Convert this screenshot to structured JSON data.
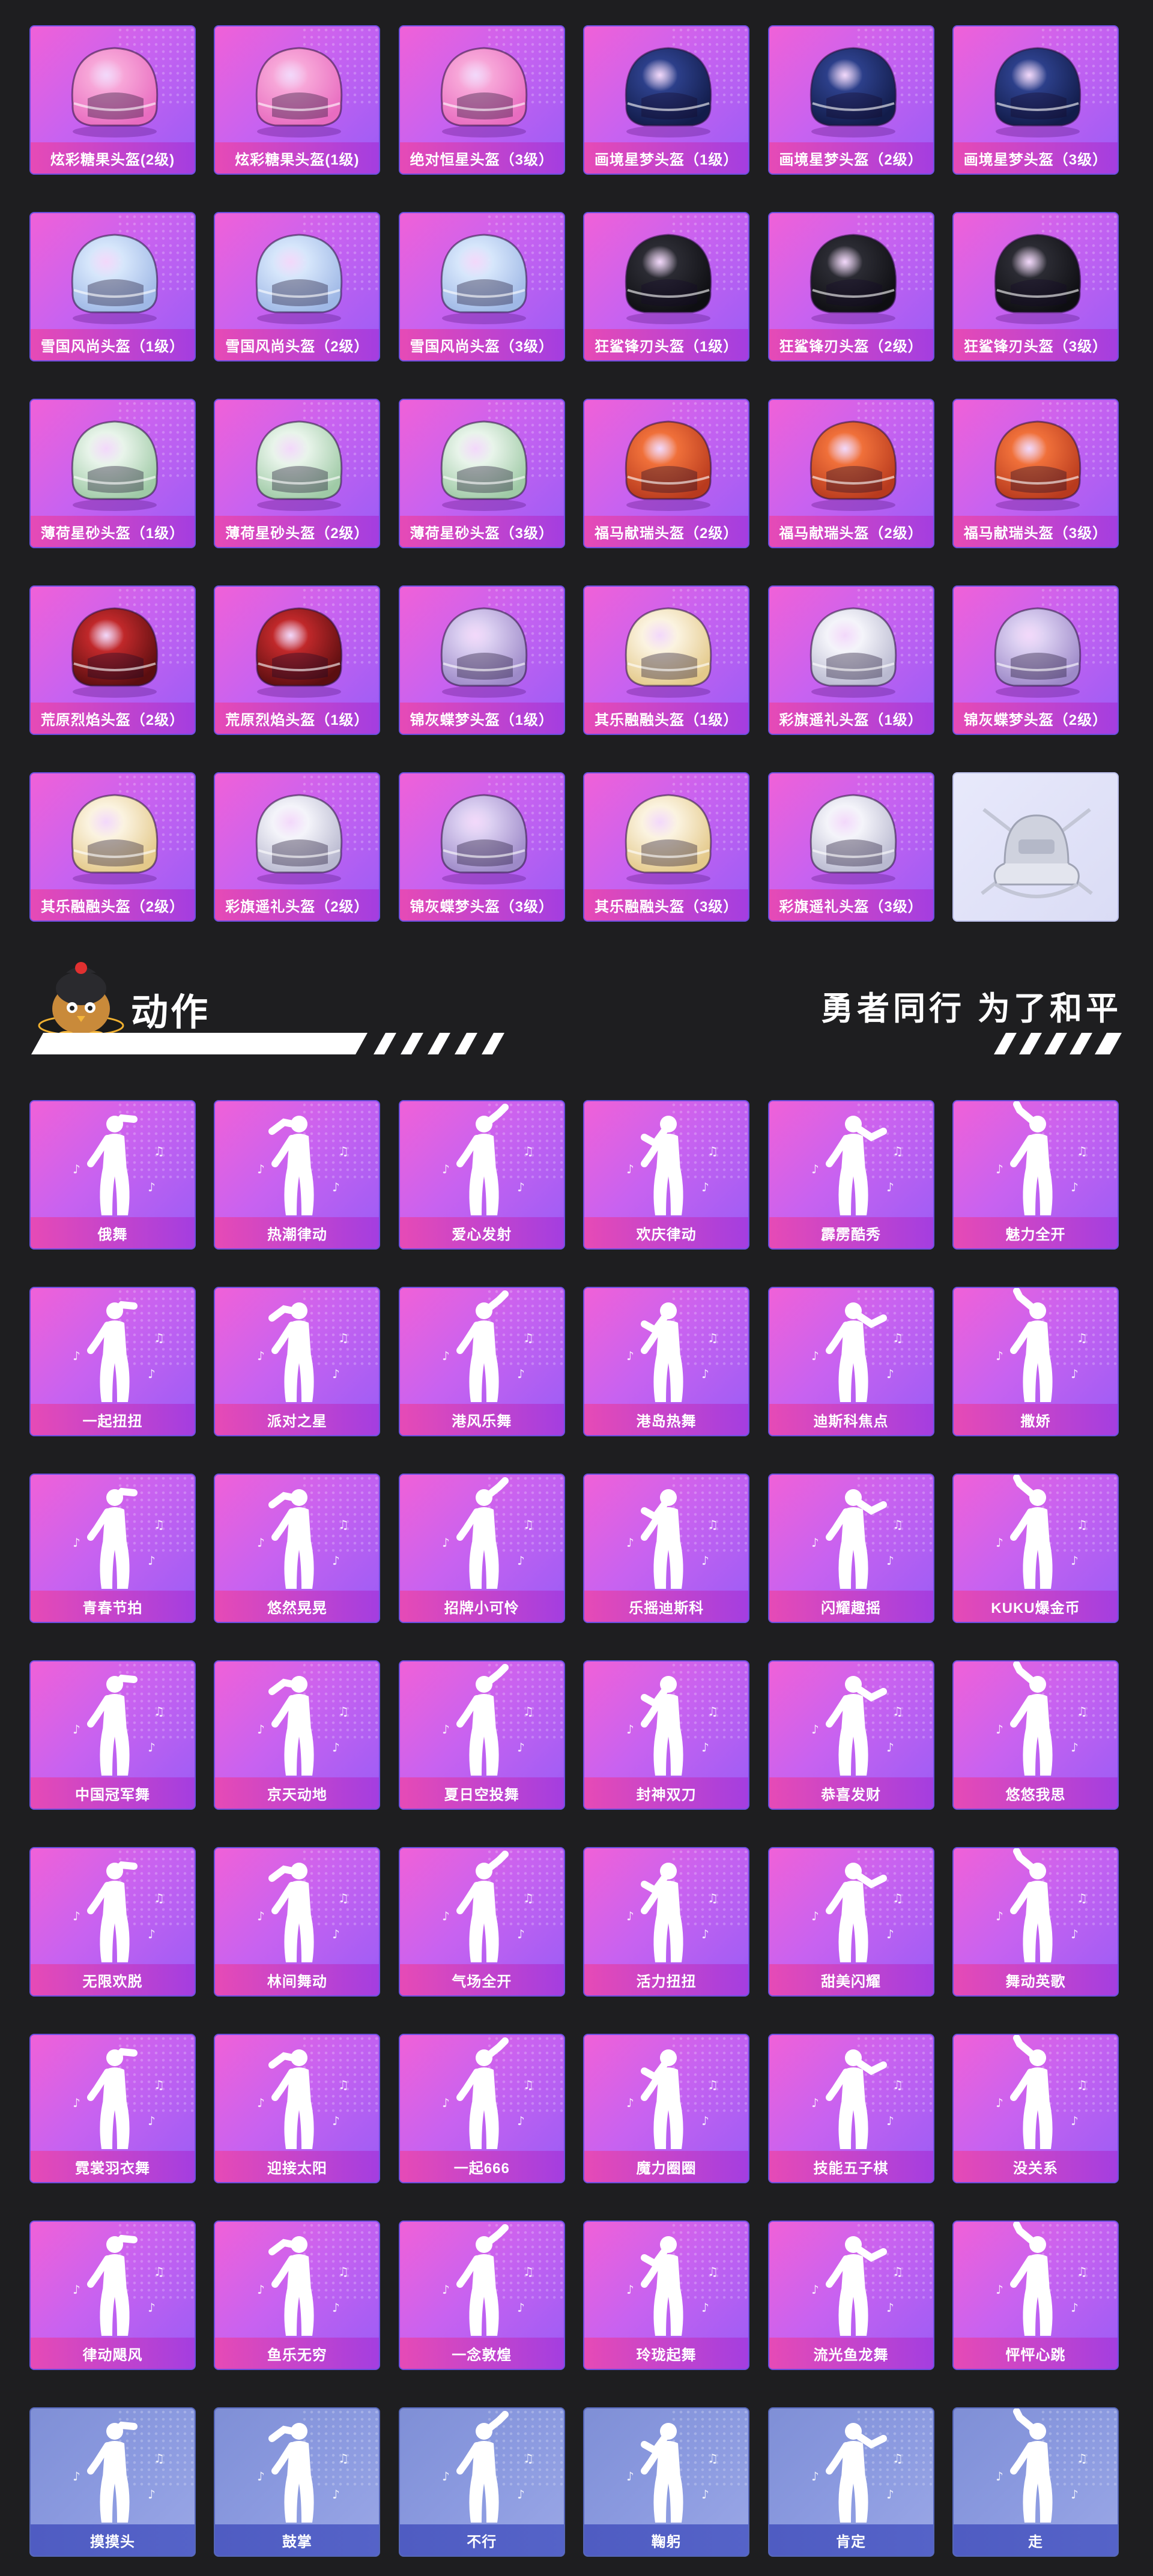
{
  "colors": {
    "background": "#1e1e20",
    "card_pink": "#f061d8",
    "card_purple": "#9a5cf5",
    "label_pink": "#e64ab6",
    "label_purple": "#a43ee0",
    "card_gray": "#8b9ae0",
    "label_gray": "#4f5cc2"
  },
  "helmets": [
    {
      "label": "炫彩糖果头盔(2级)",
      "icon": "pink-candy-helmet-icon",
      "tone": "pink"
    },
    {
      "label": "炫彩糖果头盔(1级)",
      "icon": "pink-candy-helmet-icon",
      "tone": "pink"
    },
    {
      "label": "绝对恒星头盔（3级）",
      "icon": "pink-star-helmet-icon",
      "tone": "pink"
    },
    {
      "label": "画境星梦头盔（1级）",
      "icon": "blue-star-helmet-icon",
      "tone": "blue"
    },
    {
      "label": "画境星梦头盔（2级）",
      "icon": "blue-star-helmet-icon",
      "tone": "blue"
    },
    {
      "label": "画境星梦头盔（3级）",
      "icon": "blue-star-helmet-icon",
      "tone": "blue"
    },
    {
      "label": "雪国风尚头盔（1级）",
      "icon": "snow-helmet-icon",
      "tone": "ice"
    },
    {
      "label": "雪国风尚头盔（2级）",
      "icon": "snow-helmet-icon",
      "tone": "ice"
    },
    {
      "label": "雪国风尚头盔（3级）",
      "icon": "snow-helmet-icon",
      "tone": "ice"
    },
    {
      "label": "狂鲨锋刃头盔（1级）",
      "icon": "shark-helmet-icon",
      "tone": "dark"
    },
    {
      "label": "狂鲨锋刃头盔（2级）",
      "icon": "shark-helmet-icon",
      "tone": "dark"
    },
    {
      "label": "狂鲨锋刃头盔（3级）",
      "icon": "shark-helmet-icon",
      "tone": "dark"
    },
    {
      "label": "薄荷星砂头盔（1级）",
      "icon": "mint-helmet-icon",
      "tone": "mint"
    },
    {
      "label": "薄荷星砂头盔（2级）",
      "icon": "mint-helmet-icon",
      "tone": "mint"
    },
    {
      "label": "薄荷星砂头盔（3级）",
      "icon": "mint-helmet-icon",
      "tone": "mint"
    },
    {
      "label": "福马献瑞头盔（2级）",
      "icon": "horse-helmet-icon",
      "tone": "orange"
    },
    {
      "label": "福马献瑞头盔（2级）",
      "icon": "horse-helmet-icon",
      "tone": "orange"
    },
    {
      "label": "福马献瑞头盔（3级）",
      "icon": "horse-helmet-icon",
      "tone": "orange"
    },
    {
      "label": "荒原烈焰头盔（2级）",
      "icon": "flame-helmet-icon",
      "tone": "red"
    },
    {
      "label": "荒原烈焰头盔（1级）",
      "icon": "flame-helmet-icon",
      "tone": "red"
    },
    {
      "label": "锦灰蝶梦头盔（1级）",
      "icon": "butterfly-helmet-icon",
      "tone": "lilac"
    },
    {
      "label": "其乐融融头盔（1级）",
      "icon": "cozy-helmet-icon",
      "tone": "cream"
    },
    {
      "label": "彩旗遥礼头盔（1级）",
      "icon": "flag-helmet-icon",
      "tone": "white"
    },
    {
      "label": "锦灰蝶梦头盔（2级）",
      "icon": "butterfly-helmet-icon",
      "tone": "lilac"
    },
    {
      "label": "其乐融融头盔（2级）",
      "icon": "cozy-helmet-icon",
      "tone": "cream"
    },
    {
      "label": "彩旗遥礼头盔（2级）",
      "icon": "flag-helmet-icon",
      "tone": "white"
    },
    {
      "label": "锦灰蝶梦头盔（3级）",
      "icon": "butterfly-helmet-icon",
      "tone": "lilac"
    },
    {
      "label": "其乐融融头盔（3级）",
      "icon": "cozy-helmet-icon",
      "tone": "cream"
    },
    {
      "label": "彩旗遥礼头盔（3级）",
      "icon": "flag-helmet-icon",
      "tone": "white"
    },
    {
      "label": "",
      "icon": "helmet-emblem-icon",
      "tone": "silver",
      "plain": true
    }
  ],
  "section": {
    "title": "动作",
    "slogan": "勇者同行 为了和平",
    "mascot_icon": "mascot-chick-icon"
  },
  "emotes": [
    {
      "label": "俄舞"
    },
    {
      "label": "热潮律动"
    },
    {
      "label": "爱心发射"
    },
    {
      "label": "欢庆律动"
    },
    {
      "label": "霹雳酷秀"
    },
    {
      "label": "魅力全开"
    },
    {
      "label": "一起扭扭"
    },
    {
      "label": "派对之星"
    },
    {
      "label": "港风乐舞"
    },
    {
      "label": "港岛热舞"
    },
    {
      "label": "迪斯科焦点"
    },
    {
      "label": "撒娇"
    },
    {
      "label": "青春节拍"
    },
    {
      "label": "悠然晃晃"
    },
    {
      "label": "招牌小可怜"
    },
    {
      "label": "乐摇迪斯科"
    },
    {
      "label": "闪耀趣摇"
    },
    {
      "label": "KUKU爆金币"
    },
    {
      "label": "中国冠军舞"
    },
    {
      "label": "京天动地"
    },
    {
      "label": "夏日空投舞"
    },
    {
      "label": "封神双刀"
    },
    {
      "label": "恭喜发财"
    },
    {
      "label": "悠悠我思"
    },
    {
      "label": "无限欢脱"
    },
    {
      "label": "林间舞动"
    },
    {
      "label": "气场全开"
    },
    {
      "label": "活力扭扭"
    },
    {
      "label": "甜美闪耀"
    },
    {
      "label": "舞动英歌"
    },
    {
      "label": "霓裳羽衣舞"
    },
    {
      "label": "迎接太阳"
    },
    {
      "label": "一起666"
    },
    {
      "label": "魔力圈圈"
    },
    {
      "label": "技能五子棋"
    },
    {
      "label": "没关系"
    },
    {
      "label": "律动飓风"
    },
    {
      "label": "鱼乐无穷"
    },
    {
      "label": "一念敦煌"
    },
    {
      "label": "玲珑起舞"
    },
    {
      "label": "流光鱼龙舞"
    },
    {
      "label": "怦怦心跳"
    },
    {
      "label": "摸摸头",
      "gray": true
    },
    {
      "label": "鼓掌",
      "gray": true
    },
    {
      "label": "不行",
      "gray": true
    },
    {
      "label": "鞠躬",
      "gray": true
    },
    {
      "label": "肯定",
      "gray": true
    },
    {
      "label": "走",
      "gray": true
    }
  ]
}
